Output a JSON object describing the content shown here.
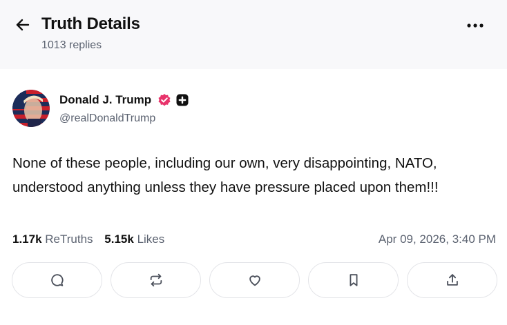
{
  "header": {
    "title": "Truth Details",
    "reply_count": "1013 replies"
  },
  "post": {
    "author": {
      "display_name": "Donald J. Trump",
      "handle": "@realDonaldTrump"
    },
    "text": "None of these people, including our own, very disappointing, NATO, understood anything unless they have pressure placed upon them!!!",
    "retruths_count": "1.17k",
    "retruths_label": "ReTruths",
    "likes_count": "5.15k",
    "likes_label": "Likes",
    "timestamp": "Apr 09, 2026, 3:40 PM"
  },
  "icons": {
    "back": "arrow-left-icon",
    "more": "more-horizontal-icon",
    "verified": "verified-badge-icon",
    "plus": "plus-badge-icon",
    "reply": "comment-icon",
    "retruth": "repost-icon",
    "like": "heart-icon",
    "bookmark": "bookmark-icon",
    "share": "share-icon"
  },
  "colors": {
    "verified_badge": "#e8336b",
    "header_background": "#f8f8fa",
    "secondary_text": "#5b6270"
  }
}
